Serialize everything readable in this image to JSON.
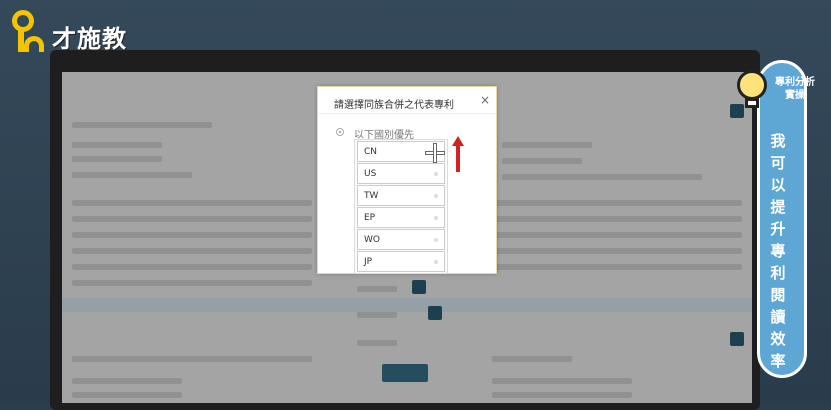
{
  "brand": {
    "name": "才施教"
  },
  "sidebar": {
    "subtitle": "專利分析 實操",
    "tagline": "我可以提升專利閱讀效率"
  },
  "dialog": {
    "title": "請選擇同族合併之代表專利",
    "close_label": "×",
    "option_label": "以下國別優先",
    "countries": [
      "CN",
      "US",
      "TW",
      "EP",
      "WO",
      "JP"
    ]
  }
}
